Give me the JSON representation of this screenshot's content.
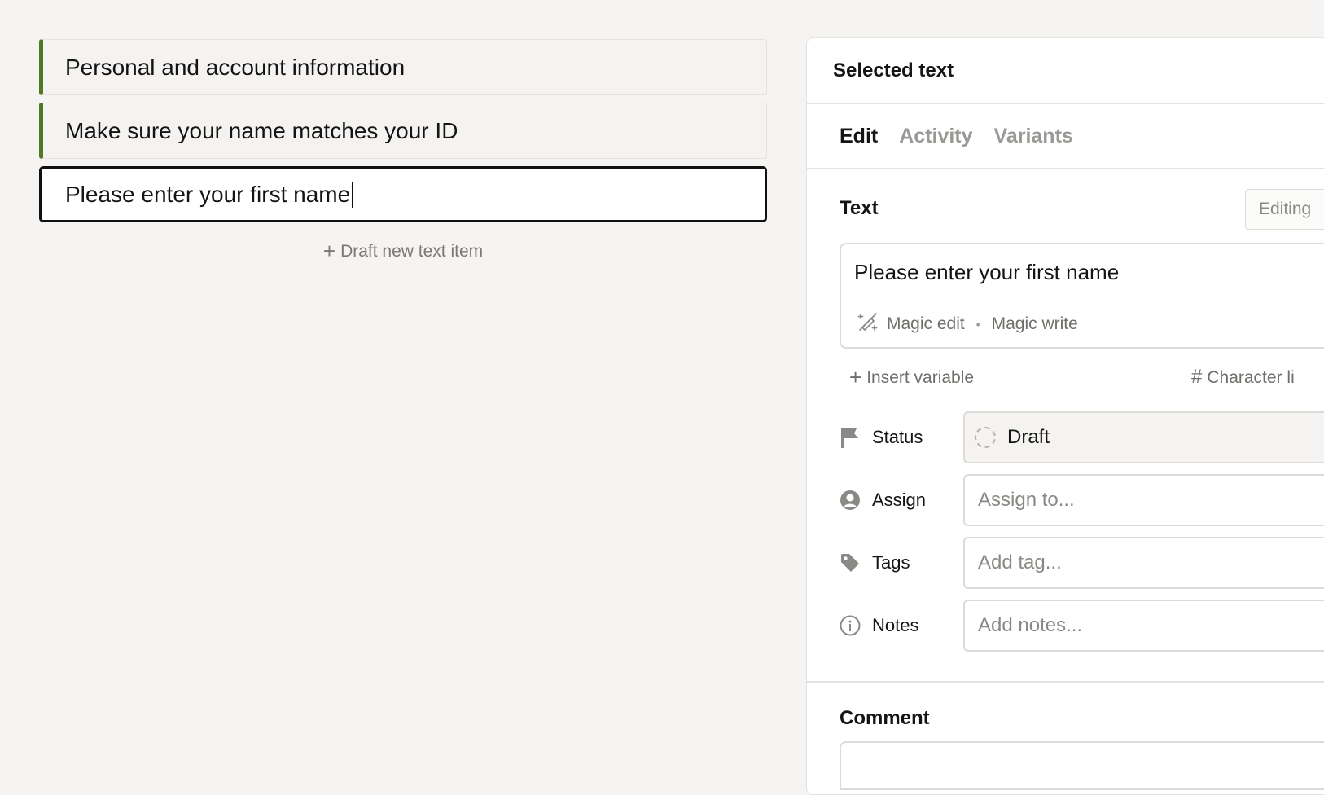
{
  "left": {
    "items": [
      {
        "text": "Personal and account information"
      },
      {
        "text": "Make sure your name matches your ID"
      },
      {
        "text": "Please enter your first name"
      }
    ],
    "draft_new_label": "Draft new text item"
  },
  "panel": {
    "title": "Selected text",
    "tabs": [
      {
        "label": "Edit",
        "active": true
      },
      {
        "label": "Activity",
        "active": false
      },
      {
        "label": "Variants",
        "active": false
      }
    ],
    "text_section": {
      "label": "Text",
      "editing_badge": "Editing",
      "value": "Please enter your first name",
      "magic_edit": "Magic edit",
      "magic_write": "Magic write",
      "separator": "•",
      "insert_variable": "Insert variable",
      "character_limit": "Character li"
    },
    "fields": {
      "status": {
        "label": "Status",
        "value": "Draft"
      },
      "assign": {
        "label": "Assign",
        "placeholder": "Assign to..."
      },
      "tags": {
        "label": "Tags",
        "placeholder": "Add tag..."
      },
      "notes": {
        "label": "Notes",
        "placeholder": "Add notes..."
      }
    },
    "comment_label": "Comment"
  },
  "colors": {
    "accent_bar": "#4f7a1d",
    "background": "#f5f4f2",
    "muted_text": "#8a8985"
  },
  "icons": {
    "plus": "plus-icon",
    "magic": "magic-wand-icon",
    "hash": "hash-icon",
    "status": "flag-icon",
    "assign": "user-icon",
    "tags": "tag-icon",
    "notes": "info-icon"
  }
}
